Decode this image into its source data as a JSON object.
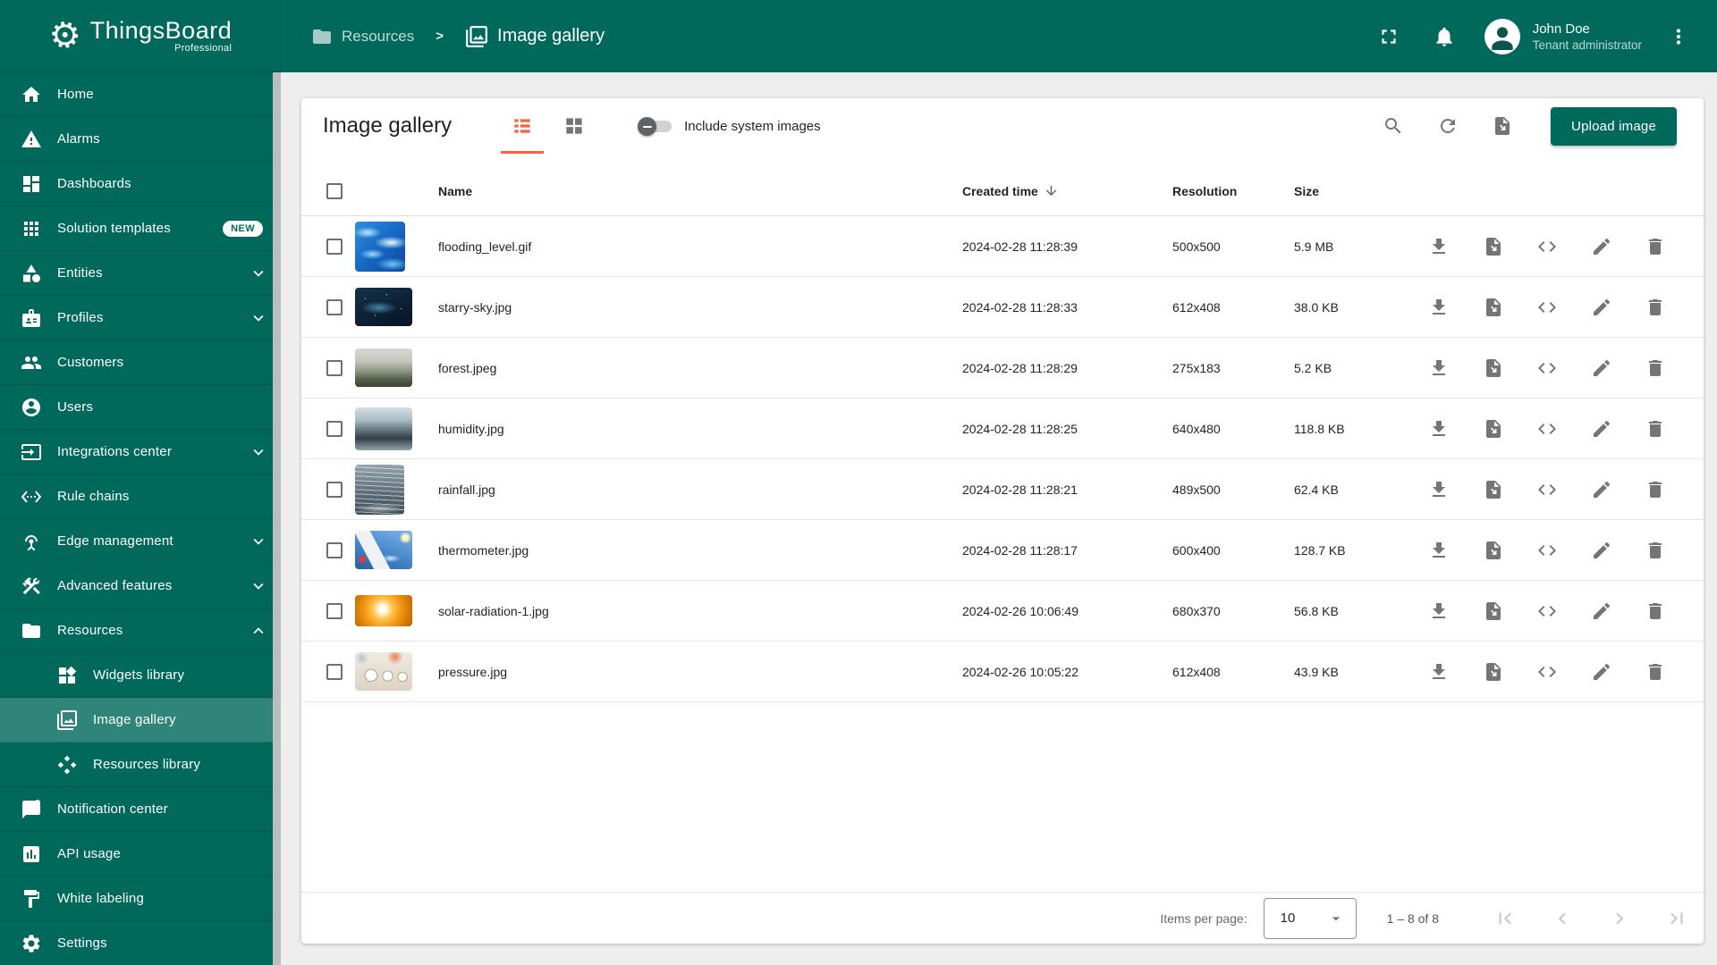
{
  "colors": {
    "primary_teal": "#00695C",
    "selected_item_teal": "#2E8478",
    "accent_orange": "#F4633C",
    "content_background": "#EEEEEE",
    "icon_gray": "#757575"
  },
  "brand": {
    "name": "ThingsBoard",
    "edition": "Professional"
  },
  "sidebar": {
    "items": [
      {
        "id": "home",
        "label": "Home",
        "icon": "home"
      },
      {
        "id": "alarms",
        "label": "Alarms",
        "icon": "warning"
      },
      {
        "id": "dashboards",
        "label": "Dashboards",
        "icon": "dashboards"
      },
      {
        "id": "solution-templates",
        "label": "Solution templates",
        "icon": "apps",
        "badge": "NEW"
      },
      {
        "id": "entities",
        "label": "Entities",
        "icon": "category",
        "chevron": "down"
      },
      {
        "id": "profiles",
        "label": "Profiles",
        "icon": "badge",
        "chevron": "down"
      },
      {
        "id": "customers",
        "label": "Customers",
        "icon": "people"
      },
      {
        "id": "users",
        "label": "Users",
        "icon": "account"
      },
      {
        "id": "integrations-center",
        "label": "Integrations center",
        "icon": "integration",
        "chevron": "down"
      },
      {
        "id": "rule-chains",
        "label": "Rule chains",
        "icon": "ethernet"
      },
      {
        "id": "edge-management",
        "label": "Edge management",
        "icon": "antenna",
        "chevron": "down"
      },
      {
        "id": "advanced-features",
        "label": "Advanced features",
        "icon": "construction",
        "chevron": "down"
      },
      {
        "id": "resources",
        "label": "Resources",
        "icon": "folder",
        "chevron": "up"
      },
      {
        "id": "widgets-library",
        "label": "Widgets library",
        "icon": "widgets",
        "indent": true
      },
      {
        "id": "image-gallery",
        "label": "Image gallery",
        "icon": "gallery",
        "indent": true,
        "selected": true
      },
      {
        "id": "resources-library",
        "label": "Resources library",
        "icon": "diamonds",
        "indent": true
      },
      {
        "id": "notification-center",
        "label": "Notification center",
        "icon": "notification"
      },
      {
        "id": "api-usage",
        "label": "API usage",
        "icon": "chart"
      },
      {
        "id": "white-labeling",
        "label": "White labeling",
        "icon": "paint"
      },
      {
        "id": "settings",
        "label": "Settings",
        "icon": "settings"
      }
    ]
  },
  "topbar": {
    "breadcrumb": {
      "parent": "Resources",
      "separator": ">",
      "current": "Image gallery"
    },
    "user": {
      "name": "John Doe",
      "role": "Tenant administrator"
    }
  },
  "toolbar": {
    "title": "Image gallery",
    "include_toggle_label": "Include system images",
    "upload_label": "Upload image"
  },
  "table": {
    "columns": [
      "Name",
      "Created time",
      "Resolution",
      "Size"
    ],
    "row_actions": [
      "download",
      "export",
      "embed",
      "edit",
      "delete"
    ],
    "rows": [
      {
        "name": "flooding_level.gif",
        "created": "2024-02-28 11:28:39",
        "resolution": "500x500",
        "size": "5.9 MB",
        "thumb": "flooding"
      },
      {
        "name": "starry-sky.jpg",
        "created": "2024-02-28 11:28:33",
        "resolution": "612x408",
        "size": "38.0 KB",
        "thumb": "starry"
      },
      {
        "name": "forest.jpeg",
        "created": "2024-02-28 11:28:29",
        "resolution": "275x183",
        "size": "5.2 KB",
        "thumb": "forest"
      },
      {
        "name": "humidity.jpg",
        "created": "2024-02-28 11:28:25",
        "resolution": "640x480",
        "size": "118.8 KB",
        "thumb": "humidity"
      },
      {
        "name": "rainfall.jpg",
        "created": "2024-02-28 11:28:21",
        "resolution": "489x500",
        "size": "62.4 KB",
        "thumb": "rainfall"
      },
      {
        "name": "thermometer.jpg",
        "created": "2024-02-28 11:28:17",
        "resolution": "600x400",
        "size": "128.7 KB",
        "thumb": "thermometer"
      },
      {
        "name": "solar-radiation-1.jpg",
        "created": "2024-02-26 10:06:49",
        "resolution": "680x370",
        "size": "56.8 KB",
        "thumb": "solar"
      },
      {
        "name": "pressure.jpg",
        "created": "2024-02-26 10:05:22",
        "resolution": "612x408",
        "size": "43.9 KB",
        "thumb": "pressure"
      }
    ]
  },
  "paginator": {
    "items_per_page_label": "Items per page:",
    "page_size": "10",
    "range_label": "1 – 8 of 8"
  }
}
